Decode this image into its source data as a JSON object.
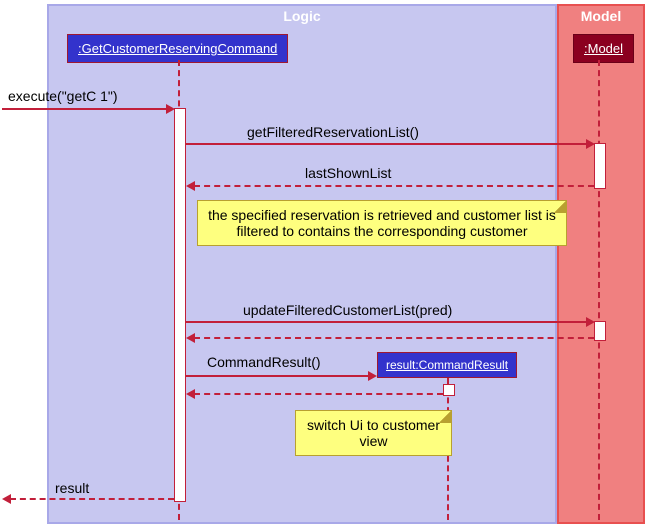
{
  "logic": {
    "title": "Logic"
  },
  "model": {
    "title": "Model"
  },
  "participants": {
    "command": ":GetCustomerReservingCommand",
    "modelObj": ":Model",
    "result": "result:CommandResult"
  },
  "messages": {
    "execute": "execute(\"getC 1\")",
    "getList": "getFilteredReservationList()",
    "lastShown": "lastShownList",
    "updateList": "updateFilteredCustomerList(pred)",
    "cmdResult": "CommandResult()",
    "resultReturn": "result"
  },
  "notes": {
    "note1": "the specified reservation is retrieved and customer list is filtered to contains the corresponding customer",
    "note2": "switch Ui to customer view"
  }
}
